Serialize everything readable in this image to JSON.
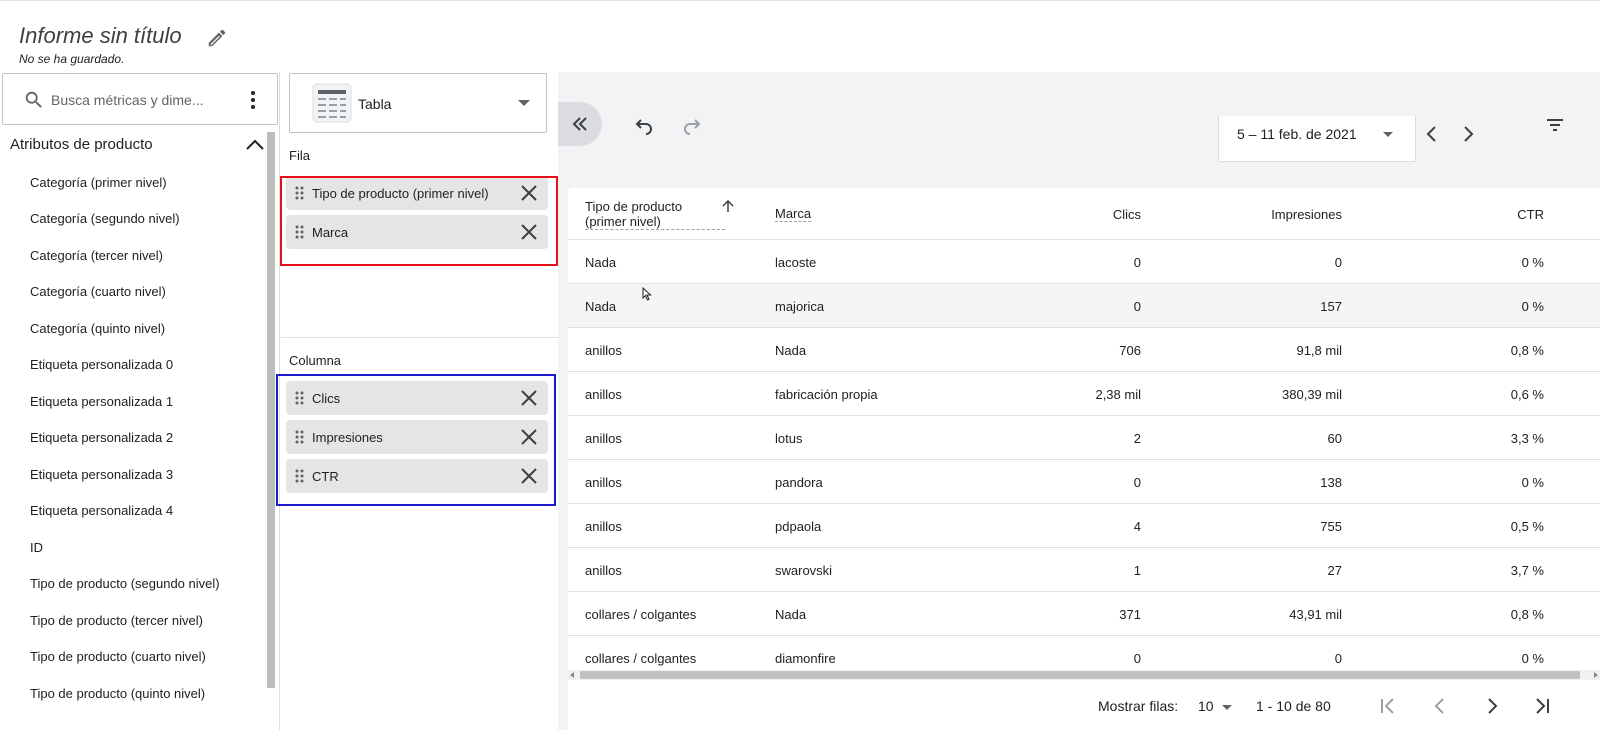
{
  "header": {
    "title": "Informe sin título",
    "save_status": "No se ha guardado."
  },
  "left_panel": {
    "search_placeholder": "Busca métricas y dime...",
    "section_title": "Atributos de producto",
    "items": [
      "Categoría (primer nivel)",
      "Categoría (segundo nivel)",
      "Categoría (tercer nivel)",
      "Categoría (cuarto nivel)",
      "Categoría (quinto nivel)",
      "Etiqueta personalizada 0",
      "Etiqueta personalizada 1",
      "Etiqueta personalizada 2",
      "Etiqueta personalizada 3",
      "Etiqueta personalizada 4",
      "ID",
      "Tipo de producto (segundo nivel)",
      "Tipo de producto (tercer nivel)",
      "Tipo de producto (cuarto nivel)",
      "Tipo de producto (quinto nivel)"
    ]
  },
  "config_panel": {
    "chart_type": "Tabla",
    "row_label": "Fila",
    "rows": [
      "Tipo de producto (primer nivel)",
      "Marca"
    ],
    "column_label": "Columna",
    "columns": [
      "Clics",
      "Impresiones",
      "CTR"
    ]
  },
  "toolbar": {
    "date_range": "5 – 11 feb. de 2021"
  },
  "table": {
    "headers": {
      "dim1": "Tipo de producto (primer nivel)",
      "dim2": "Marca",
      "clicks": "Clics",
      "impressions": "Impresiones",
      "ctr": "CTR"
    },
    "rows": [
      [
        "Nada",
        "lacoste",
        "0",
        "0",
        "0 %"
      ],
      [
        "Nada",
        "majorica",
        "0",
        "157",
        "0 %"
      ],
      [
        "anillos",
        "Nada",
        "706",
        "91,8 mil",
        "0,8 %"
      ],
      [
        "anillos",
        "fabricación propia",
        "2,38 mil",
        "380,39 mil",
        "0,6 %"
      ],
      [
        "anillos",
        "lotus",
        "2",
        "60",
        "3,3 %"
      ],
      [
        "anillos",
        "pandora",
        "0",
        "138",
        "0 %"
      ],
      [
        "anillos",
        "pdpaola",
        "4",
        "755",
        "0,5 %"
      ],
      [
        "anillos",
        "swarovski",
        "1",
        "27",
        "3,7 %"
      ],
      [
        "collares / colgantes",
        "Nada",
        "371",
        "43,91 mil",
        "0,8 %"
      ],
      [
        "collares / colgantes",
        "diamonfire",
        "0",
        "0",
        "0 %"
      ]
    ]
  },
  "pagination": {
    "rows_label": "Mostrar filas:",
    "rows_value": "10",
    "range": "1 - 10 de 80"
  },
  "colors": {
    "highlight_rows": "#e5101b",
    "highlight_columns": "#1a1acc"
  }
}
